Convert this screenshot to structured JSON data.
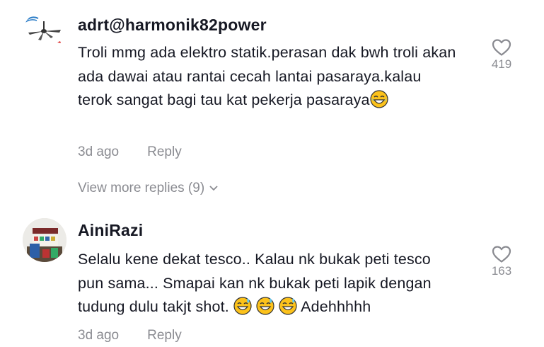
{
  "comments": [
    {
      "username": "adrt@harmonik82power",
      "text_before": "Troli mmg ada elektro statik.perasan dak bwh troli akan ada dawai atau rantai cecah lantai pasaraya.kalau terok sangat bagi tau kat pekerja pasaraya",
      "emoji": "face-with-tears-of-joy-emoji",
      "time": "3d ago",
      "reply_label": "Reply",
      "likes": "419",
      "view_more": "View more replies (9)"
    },
    {
      "username": "AiniRazi",
      "text_before": "Selalu kene dekat tesco.. Kalau nk bukak peti tesco pun sama... Smapai kan nk bukak peti lapik dengan tudung dulu takjt shot.",
      "emoji": "grinning-face-with-sweat-emoji",
      "text_after": "Adehhhhh",
      "time": "3d ago",
      "reply_label": "Reply",
      "likes": "163"
    }
  ]
}
